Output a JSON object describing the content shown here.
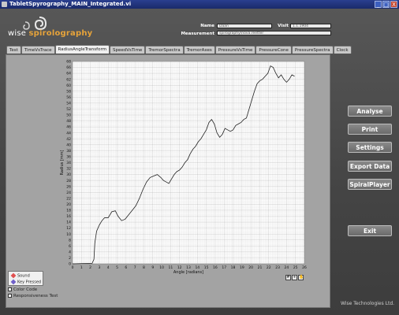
{
  "window": {
    "title": "TabletSpyrography_MAIN_Integrated.vi",
    "buttons": [
      "_",
      "□",
      "X"
    ]
  },
  "logo": {
    "text_part1": "wise ",
    "text_part2": "spirolography"
  },
  "fields": {
    "name_label": "Name",
    "name_value": "Daan",
    "visit_label": "Visit",
    "visit_value": "1.1.1904",
    "measurement_label": "Measurement",
    "measurement_value": "spirography\\nova.reetter"
  },
  "tabs": [
    "Test",
    "TimeVsTrace",
    "RadiusAngleTransform",
    "SpeedVsTime",
    "TremorSpectra",
    "TremorAxes",
    "PressureVsTime",
    "PressureCone",
    "PressureSpectra",
    "Clock"
  ],
  "active_tab": "RadiusAngleTransform",
  "legend": {
    "sound": {
      "label": "Sound",
      "color": "#e05050"
    },
    "key_pressed": {
      "label": "Key Pressed",
      "color": "#6f5fc9"
    }
  },
  "checkboxes": {
    "color_code": "Color Code",
    "responsiveness": "Responsiveness Test"
  },
  "side_buttons": {
    "analyse": "Analyse",
    "print": "Print",
    "settings": "Settings",
    "export": "Export Data",
    "spiral_player": "SpiralPlayer",
    "exit": "Exit"
  },
  "footer": "Wise Technologies Ltd.",
  "chart_data": {
    "type": "line",
    "xlabel": "Angle [radians]",
    "ylabel": "Radius [mm]",
    "xlim": [
      0,
      26
    ],
    "ylim": [
      0,
      68
    ],
    "x_ticks": [
      0,
      1,
      2,
      3,
      4,
      5,
      6,
      7,
      8,
      9,
      10,
      11,
      12,
      13,
      14,
      15,
      16,
      17,
      18,
      19,
      20,
      21,
      22,
      23,
      24,
      25,
      26
    ],
    "y_ticks": [
      0,
      2,
      4,
      6,
      8,
      10,
      12,
      14,
      16,
      18,
      20,
      22,
      24,
      26,
      28,
      30,
      32,
      34,
      36,
      38,
      40,
      42,
      44,
      46,
      48,
      50,
      52,
      54,
      56,
      58,
      60,
      62,
      64,
      66,
      68
    ],
    "grid": true,
    "line_color": "#222222",
    "x": [
      0,
      2.2,
      2.4,
      2.5,
      2.7,
      3.0,
      3.3,
      3.6,
      4.0,
      4.4,
      4.8,
      5.1,
      5.5,
      5.9,
      6.3,
      6.7,
      7.1,
      7.5,
      7.9,
      8.3,
      8.7,
      9.1,
      9.5,
      9.9,
      10.2,
      10.5,
      10.8,
      11.1,
      11.4,
      11.7,
      12.0,
      12.3,
      12.6,
      12.9,
      13.2,
      13.5,
      13.8,
      14.1,
      14.4,
      14.7,
      15.0,
      15.3,
      15.6,
      15.9,
      16.2,
      16.5,
      16.8,
      17.1,
      17.4,
      17.7,
      18.0,
      18.3,
      18.6,
      18.9,
      19.2,
      19.5,
      19.8,
      20.1,
      20.4,
      20.7,
      21.0,
      21.3,
      21.6,
      21.9,
      22.2,
      22.5,
      22.8,
      23.1,
      23.4,
      23.7,
      24.0,
      24.3,
      24.6,
      24.9
    ],
    "y": [
      0,
      0.2,
      1.5,
      7,
      11,
      13,
      14.5,
      15.5,
      15.5,
      17.5,
      17.8,
      16,
      14.5,
      15,
      16.5,
      18,
      19.5,
      22,
      25,
      27.5,
      29,
      29.5,
      30,
      29,
      28,
      27.5,
      27,
      28.5,
      30,
      31,
      31.5,
      32.5,
      34,
      35,
      37,
      38.5,
      39.5,
      41,
      42,
      43.5,
      45,
      47.5,
      48.5,
      47,
      44,
      42.5,
      43.5,
      45.5,
      45,
      44.5,
      45,
      46.5,
      47,
      47.5,
      48.5,
      49,
      52,
      55,
      58,
      60.5,
      61.5,
      62,
      63,
      64,
      66.5,
      66,
      64,
      62.5,
      63.5,
      62,
      61,
      62,
      63.5,
      63
    ]
  }
}
